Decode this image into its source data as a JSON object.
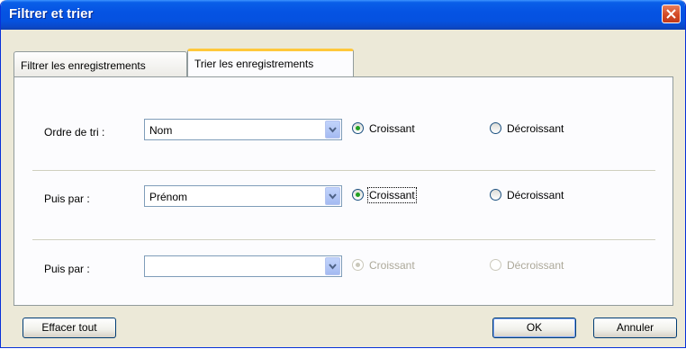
{
  "window": {
    "title": "Filtrer et trier"
  },
  "tabs": [
    {
      "label": "Filtrer les enregistrements",
      "active": false
    },
    {
      "label": "Trier les enregistrements",
      "active": true
    }
  ],
  "sort_rows": [
    {
      "label": "Ordre de tri :",
      "value": "Nom",
      "ascending_label": "Croissant",
      "descending_label": "Décroissant",
      "selected": "ascending",
      "enabled": true
    },
    {
      "label": "Puis par :",
      "value": "Prénom",
      "ascending_label": "Croissant",
      "descending_label": "Décroissant",
      "selected": "ascending",
      "enabled": true
    },
    {
      "label": "Puis par :",
      "value": "",
      "ascending_label": "Croissant",
      "descending_label": "Décroissant",
      "selected": "ascending",
      "enabled": false
    }
  ],
  "buttons": {
    "clear": "Effacer tout",
    "ok": "OK",
    "cancel": "Annuler"
  },
  "colors": {
    "titlebar": "#0553e3",
    "tab_highlight": "#ffc83c",
    "radio_dot": "#21a121",
    "disabled_text": "#aca899"
  },
  "icons": {
    "close": "close-icon",
    "dropdown": "chevron-down-icon"
  }
}
